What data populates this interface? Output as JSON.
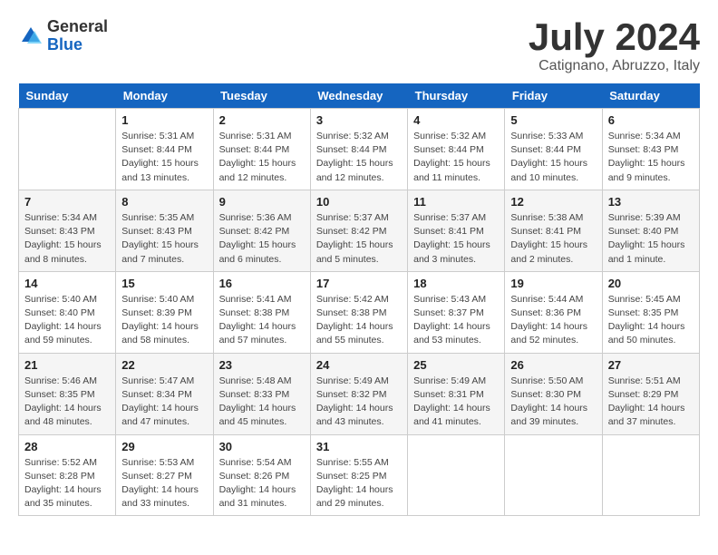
{
  "logo": {
    "general": "General",
    "blue": "Blue"
  },
  "title": "July 2024",
  "subtitle": "Catignano, Abruzzo, Italy",
  "days_header": [
    "Sunday",
    "Monday",
    "Tuesday",
    "Wednesday",
    "Thursday",
    "Friday",
    "Saturday"
  ],
  "weeks": [
    [
      {
        "day": "",
        "info": ""
      },
      {
        "day": "1",
        "info": "Sunrise: 5:31 AM\nSunset: 8:44 PM\nDaylight: 15 hours\nand 13 minutes."
      },
      {
        "day": "2",
        "info": "Sunrise: 5:31 AM\nSunset: 8:44 PM\nDaylight: 15 hours\nand 12 minutes."
      },
      {
        "day": "3",
        "info": "Sunrise: 5:32 AM\nSunset: 8:44 PM\nDaylight: 15 hours\nand 12 minutes."
      },
      {
        "day": "4",
        "info": "Sunrise: 5:32 AM\nSunset: 8:44 PM\nDaylight: 15 hours\nand 11 minutes."
      },
      {
        "day": "5",
        "info": "Sunrise: 5:33 AM\nSunset: 8:44 PM\nDaylight: 15 hours\nand 10 minutes."
      },
      {
        "day": "6",
        "info": "Sunrise: 5:34 AM\nSunset: 8:43 PM\nDaylight: 15 hours\nand 9 minutes."
      }
    ],
    [
      {
        "day": "7",
        "info": "Sunrise: 5:34 AM\nSunset: 8:43 PM\nDaylight: 15 hours\nand 8 minutes."
      },
      {
        "day": "8",
        "info": "Sunrise: 5:35 AM\nSunset: 8:43 PM\nDaylight: 15 hours\nand 7 minutes."
      },
      {
        "day": "9",
        "info": "Sunrise: 5:36 AM\nSunset: 8:42 PM\nDaylight: 15 hours\nand 6 minutes."
      },
      {
        "day": "10",
        "info": "Sunrise: 5:37 AM\nSunset: 8:42 PM\nDaylight: 15 hours\nand 5 minutes."
      },
      {
        "day": "11",
        "info": "Sunrise: 5:37 AM\nSunset: 8:41 PM\nDaylight: 15 hours\nand 3 minutes."
      },
      {
        "day": "12",
        "info": "Sunrise: 5:38 AM\nSunset: 8:41 PM\nDaylight: 15 hours\nand 2 minutes."
      },
      {
        "day": "13",
        "info": "Sunrise: 5:39 AM\nSunset: 8:40 PM\nDaylight: 15 hours\nand 1 minute."
      }
    ],
    [
      {
        "day": "14",
        "info": "Sunrise: 5:40 AM\nSunset: 8:40 PM\nDaylight: 14 hours\nand 59 minutes."
      },
      {
        "day": "15",
        "info": "Sunrise: 5:40 AM\nSunset: 8:39 PM\nDaylight: 14 hours\nand 58 minutes."
      },
      {
        "day": "16",
        "info": "Sunrise: 5:41 AM\nSunset: 8:38 PM\nDaylight: 14 hours\nand 57 minutes."
      },
      {
        "day": "17",
        "info": "Sunrise: 5:42 AM\nSunset: 8:38 PM\nDaylight: 14 hours\nand 55 minutes."
      },
      {
        "day": "18",
        "info": "Sunrise: 5:43 AM\nSunset: 8:37 PM\nDaylight: 14 hours\nand 53 minutes."
      },
      {
        "day": "19",
        "info": "Sunrise: 5:44 AM\nSunset: 8:36 PM\nDaylight: 14 hours\nand 52 minutes."
      },
      {
        "day": "20",
        "info": "Sunrise: 5:45 AM\nSunset: 8:35 PM\nDaylight: 14 hours\nand 50 minutes."
      }
    ],
    [
      {
        "day": "21",
        "info": "Sunrise: 5:46 AM\nSunset: 8:35 PM\nDaylight: 14 hours\nand 48 minutes."
      },
      {
        "day": "22",
        "info": "Sunrise: 5:47 AM\nSunset: 8:34 PM\nDaylight: 14 hours\nand 47 minutes."
      },
      {
        "day": "23",
        "info": "Sunrise: 5:48 AM\nSunset: 8:33 PM\nDaylight: 14 hours\nand 45 minutes."
      },
      {
        "day": "24",
        "info": "Sunrise: 5:49 AM\nSunset: 8:32 PM\nDaylight: 14 hours\nand 43 minutes."
      },
      {
        "day": "25",
        "info": "Sunrise: 5:49 AM\nSunset: 8:31 PM\nDaylight: 14 hours\nand 41 minutes."
      },
      {
        "day": "26",
        "info": "Sunrise: 5:50 AM\nSunset: 8:30 PM\nDaylight: 14 hours\nand 39 minutes."
      },
      {
        "day": "27",
        "info": "Sunrise: 5:51 AM\nSunset: 8:29 PM\nDaylight: 14 hours\nand 37 minutes."
      }
    ],
    [
      {
        "day": "28",
        "info": "Sunrise: 5:52 AM\nSunset: 8:28 PM\nDaylight: 14 hours\nand 35 minutes."
      },
      {
        "day": "29",
        "info": "Sunrise: 5:53 AM\nSunset: 8:27 PM\nDaylight: 14 hours\nand 33 minutes."
      },
      {
        "day": "30",
        "info": "Sunrise: 5:54 AM\nSunset: 8:26 PM\nDaylight: 14 hours\nand 31 minutes."
      },
      {
        "day": "31",
        "info": "Sunrise: 5:55 AM\nSunset: 8:25 PM\nDaylight: 14 hours\nand 29 minutes."
      },
      {
        "day": "",
        "info": ""
      },
      {
        "day": "",
        "info": ""
      },
      {
        "day": "",
        "info": ""
      }
    ]
  ]
}
